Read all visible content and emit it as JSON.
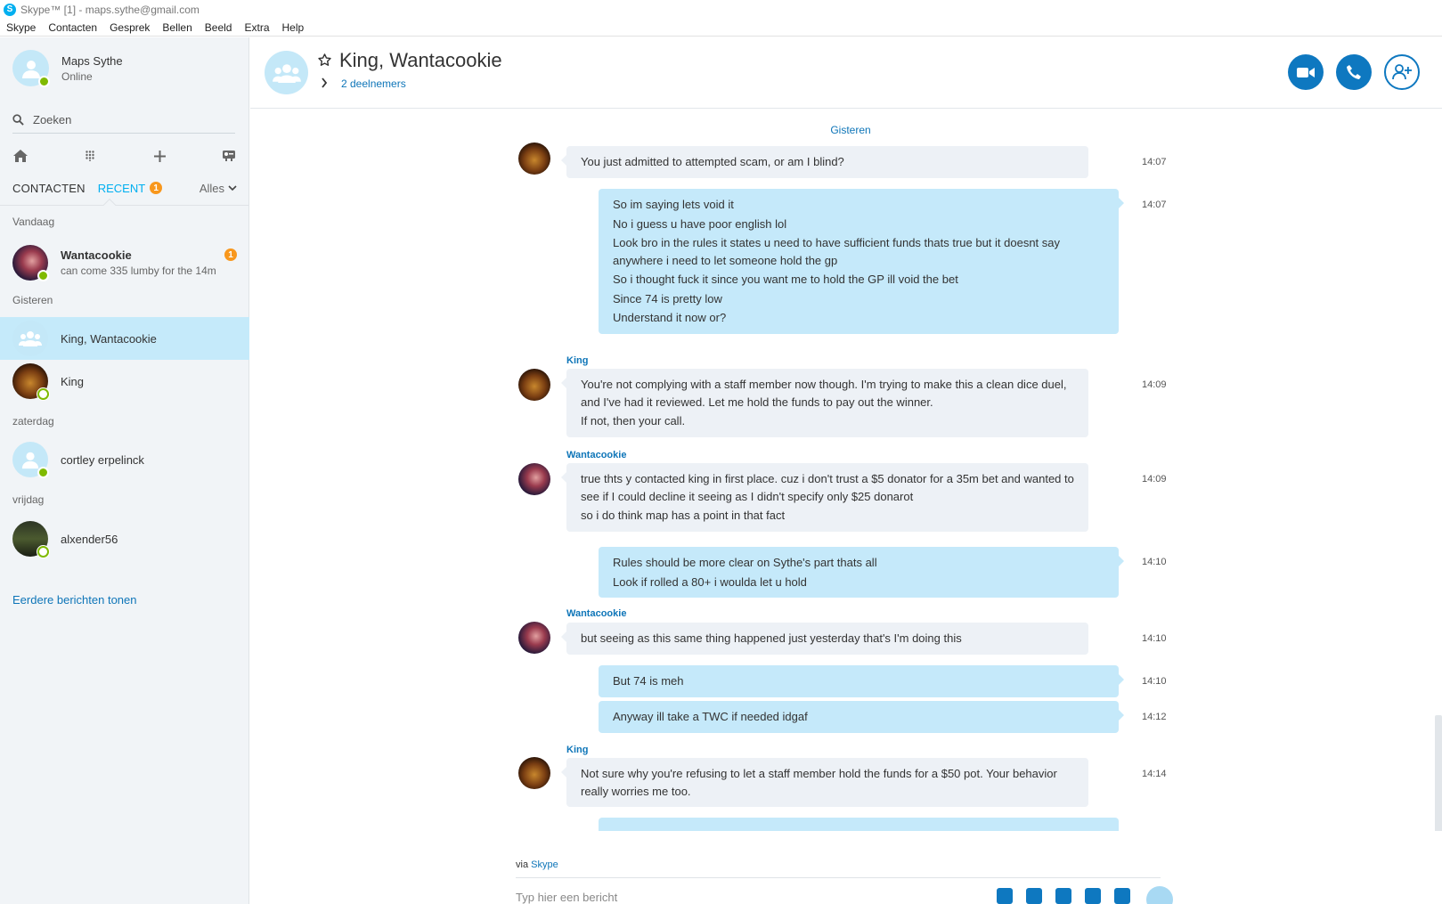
{
  "window": {
    "title": "Skype™ [1] - maps.sythe@gmail.com",
    "menu": [
      "Skype",
      "Contacten",
      "Gesprek",
      "Bellen",
      "Beeld",
      "Extra",
      "Help"
    ]
  },
  "profile": {
    "name": "Maps Sythe",
    "status": "Online"
  },
  "search": {
    "placeholder": "Zoeken"
  },
  "tabs": {
    "contacts": "CONTACTEN",
    "recent": "RECENT",
    "recent_badge": "1",
    "filter": "Alles"
  },
  "sections": {
    "today": "Vandaag",
    "yesterday": "Gisteren",
    "saturday": "zaterdag",
    "friday": "vrijdag"
  },
  "conversations": [
    {
      "name": "Wantacookie",
      "preview": "can come 335 lumby for the 14m",
      "badge": "1"
    },
    {
      "name": "King, Wantacookie"
    },
    {
      "name": "King"
    },
    {
      "name": "cortley erpelinck"
    },
    {
      "name": "alxender56"
    }
  ],
  "more_messages": "Eerdere berichten tonen",
  "header": {
    "title": "King, Wantacookie",
    "participants": "2 deelnemers"
  },
  "chat": {
    "day_label": "Gisteren",
    "messages": [
      {
        "sender": "",
        "time": "14:07",
        "lines": [
          "You just admitted to attempted scam, or am I blind?"
        ]
      },
      {
        "sender": "",
        "time": "14:07",
        "lines": [
          "So im saying lets void it",
          "No i guess u have  poor english lol",
          "Look bro in the rules it states u need to have sufficient funds thats true but it doesnt say anywhere i need to let someone hold the gp",
          "So i thought fuck it since you want me to hold the GP ill void the bet",
          "Since 74 is pretty low",
          "Understand it now or?"
        ]
      },
      {
        "sender": "King",
        "time": "14:09",
        "lines": [
          "You're not complying with a staff member now though. I'm trying to make this a clean dice duel, and I've had it reviewed. Let me hold the funds to pay out the winner.",
          "If not, then your call."
        ]
      },
      {
        "sender": "Wantacookie",
        "time": "14:09",
        "lines": [
          "true thts y contacted king in first place. cuz i don't trust a $5 donator for a 35m bet and wanted to see if I could decline it seeing as I didn't specify only $25 donarot",
          "so i do think map has a point in that fact"
        ]
      },
      {
        "sender": "",
        "time": "14:10",
        "lines": [
          "Rules should be more clear on Sythe's part thats all",
          "Look if rolled a 80+ i woulda let u hold"
        ]
      },
      {
        "sender": "Wantacookie",
        "time": "14:10",
        "lines": [
          "but seeing as this same thing happened just yesterday that's I'm doing this"
        ]
      },
      {
        "sender": "",
        "time": "14:10",
        "lines": [
          "But 74 is meh"
        ]
      },
      {
        "sender": "",
        "time": "14:12",
        "lines": [
          "Anyway ill take a TWC if needed idgaf"
        ]
      },
      {
        "sender": "King",
        "time": "14:14",
        "lines": [
          "Not sure why you're refusing to let a staff member hold the funds for a $50 pot. Your behavior really worries me too."
        ]
      }
    ]
  },
  "footer": {
    "via_prefix": "via",
    "via_link": "Skype",
    "composer_placeholder": "Typ hier een bericht"
  },
  "colors": {
    "accent": "#00aff0",
    "button": "#0e78c0",
    "outgoing": "#c5e9fa",
    "incoming": "#edf1f6",
    "online": "#7fba00",
    "badge": "#f8971d"
  }
}
